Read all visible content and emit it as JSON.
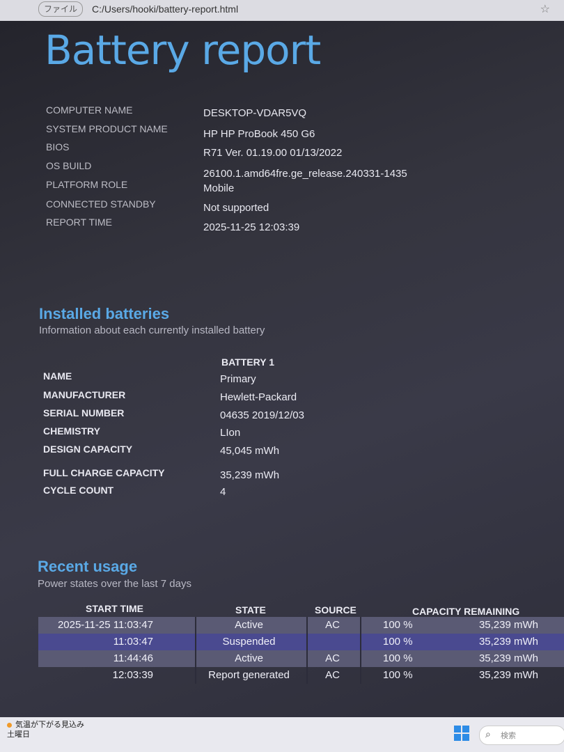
{
  "address_bar": {
    "info_label": "ファイル",
    "url": "C:/Users/hooki/battery-report.html"
  },
  "report": {
    "title": "Battery report",
    "system_info": [
      {
        "label": "COMPUTER NAME",
        "value": "DESKTOP-VDAR5VQ"
      },
      {
        "label": "SYSTEM PRODUCT NAME",
        "value": "HP HP ProBook 450 G6"
      },
      {
        "label": "BIOS",
        "value": "R71 Ver. 01.19.00 01/13/2022"
      },
      {
        "label": "OS BUILD",
        "value": "26100.1.amd64fre.ge_release.240331-1435"
      },
      {
        "label": "PLATFORM ROLE",
        "value": "Mobile"
      },
      {
        "label": "CONNECTED STANDBY",
        "value": "Not supported"
      },
      {
        "label": "REPORT TIME",
        "value": "2025-11-25  12:03:39"
      }
    ]
  },
  "installed_batteries": {
    "heading": "Installed batteries",
    "subheading": "Information about each currently installed battery",
    "battery_header": "BATTERY 1",
    "fields": [
      {
        "label": "NAME",
        "value": "Primary"
      },
      {
        "label": "MANUFACTURER",
        "value": "Hewlett-Packard"
      },
      {
        "label": "SERIAL NUMBER",
        "value": "04635 2019/12/03"
      },
      {
        "label": "CHEMISTRY",
        "value": "LIon"
      },
      {
        "label": "DESIGN CAPACITY",
        "value": "45,045 mWh"
      },
      {
        "label": "FULL CHARGE CAPACITY",
        "value": "35,239 mWh"
      },
      {
        "label": "CYCLE COUNT",
        "value": "4"
      }
    ]
  },
  "recent_usage": {
    "heading": "Recent usage",
    "subheading": "Power states over the last 7 days",
    "columns": {
      "start_time": "START TIME",
      "state": "STATE",
      "source": "SOURCE",
      "capacity": "CAPACITY REMAINING"
    },
    "rows": [
      {
        "time": "2025-11-25  11:03:47",
        "state": "Active",
        "source": "AC",
        "percent": "100 %",
        "capacity": "35,239 mWh"
      },
      {
        "time": "11:03:47",
        "state": "Suspended",
        "source": "",
        "percent": "100 %",
        "capacity": "35,239 mWh"
      },
      {
        "time": "11:44:46",
        "state": "Active",
        "source": "AC",
        "percent": "100 %",
        "capacity": "35,239 mWh"
      },
      {
        "time": "12:03:39",
        "state": "Report generated",
        "source": "AC",
        "percent": "100 %",
        "capacity": "35,239 mWh"
      }
    ]
  },
  "taskbar": {
    "weather_line1": "気温が下がる見込み",
    "weather_line2": "土曜日",
    "search_placeholder": "検索"
  }
}
